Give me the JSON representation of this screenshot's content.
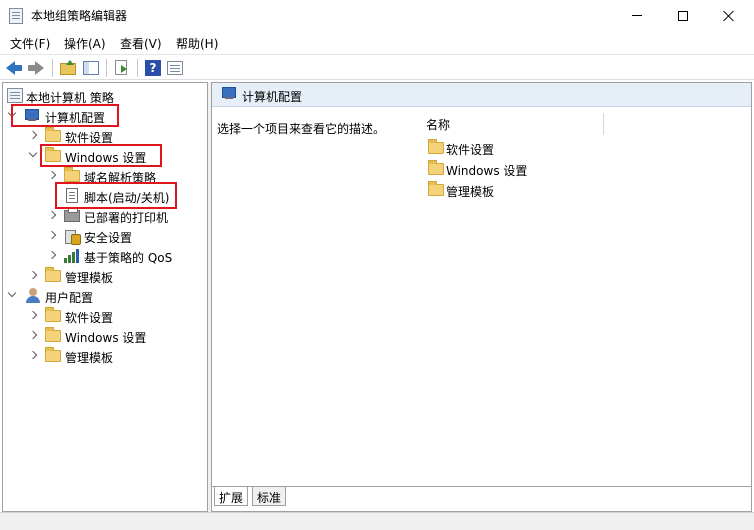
{
  "window": {
    "title": "本地组策略编辑器",
    "icon": "policy-editor-icon",
    "controls": [
      "minimize-icon",
      "maximize-icon",
      "close-icon"
    ]
  },
  "menu": {
    "items": [
      {
        "label": "文件(F)"
      },
      {
        "label": "操作(A)"
      },
      {
        "label": "查看(V)"
      },
      {
        "label": "帮助(H)"
      }
    ]
  },
  "toolbar": {
    "buttons": [
      "back-arrow-icon",
      "forward-arrow-icon",
      "up-folder-icon",
      "show-hide-tree-icon",
      "export-list-icon",
      "help-icon",
      "properties-icon"
    ],
    "help_glyph": "?"
  },
  "tree": {
    "root_label": "本地计算机 策略",
    "items": [
      {
        "label": "计算机配置",
        "icon": "computer-icon",
        "expanded": true,
        "highlighted": true
      },
      {
        "label": "软件设置",
        "icon": "folder-icon",
        "expanded": false
      },
      {
        "label": "Windows 设置",
        "icon": "folder-icon",
        "expanded": true,
        "highlighted": true
      },
      {
        "label": "域名解析策略",
        "icon": "folder-icon",
        "expanded": false
      },
      {
        "label": "脚本(启动/关机)",
        "icon": "script-icon",
        "highlighted": true
      },
      {
        "label": "已部署的打印机",
        "icon": "printer-icon",
        "expanded": false
      },
      {
        "label": "安全设置",
        "icon": "security-icon",
        "expanded": false
      },
      {
        "label": "基于策略的 QoS",
        "icon": "qos-icon",
        "expanded": false
      },
      {
        "label": "管理模板",
        "icon": "folder-icon",
        "expanded": false
      },
      {
        "label": "用户配置",
        "icon": "user-icon",
        "expanded": true
      },
      {
        "label": "软件设置",
        "icon": "folder-icon",
        "expanded": false
      },
      {
        "label": "Windows 设置",
        "icon": "folder-icon",
        "expanded": false
      },
      {
        "label": "管理模板",
        "icon": "folder-icon",
        "expanded": false
      }
    ]
  },
  "details": {
    "header_title": "计算机配置",
    "description": "选择一个项目来查看它的描述。",
    "column_name": "名称",
    "items": [
      {
        "label": "软件设置"
      },
      {
        "label": "Windows 设置"
      },
      {
        "label": "管理模板"
      }
    ]
  },
  "tabs": [
    {
      "label": "扩展"
    },
    {
      "label": "标准"
    }
  ],
  "colors": {
    "highlight_border": "#e0141e",
    "header_background": "#e6eef8",
    "folder": "#f3d27a"
  }
}
